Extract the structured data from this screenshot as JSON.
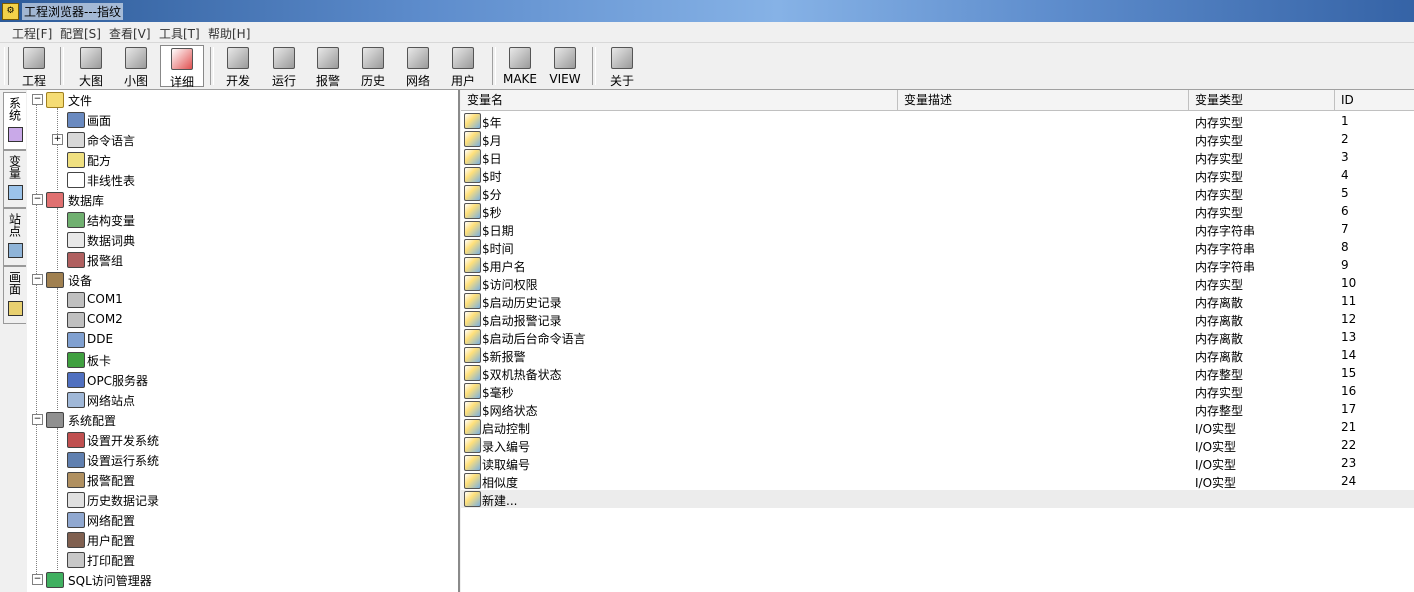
{
  "window": {
    "title": "工程浏览器---指纹"
  },
  "menu": [
    "工程[F]",
    "配置[S]",
    "查看[V]",
    "工具[T]",
    "帮助[H]"
  ],
  "toolbar": {
    "project": "工程",
    "large": "大图",
    "small": "小图",
    "detail": "详细",
    "develop": "开发",
    "run": "运行",
    "alarm": "报警",
    "history": "历史",
    "network": "网络",
    "user": "用户",
    "make": "MAKE",
    "view": "VIEW",
    "about": "关于"
  },
  "side_tabs": [
    "系统",
    "变量",
    "站点",
    "画面"
  ],
  "tree": {
    "file": "文件",
    "screen": "画面",
    "cmd_lang": "命令语言",
    "recipe": "配方",
    "nonlinear": "非线性表",
    "database": "数据库",
    "struct_var": "结构变量",
    "data_dict": "数据词典",
    "alarm_group": "报警组",
    "device": "设备",
    "com1": "COM1",
    "com2": "COM2",
    "dde": "DDE",
    "board": "板卡",
    "opc": "OPC服务器",
    "net_station": "网络站点",
    "sys_config": "系统配置",
    "dev_sys": "设置开发系统",
    "run_sys": "设置运行系统",
    "alarm_cfg": "报警配置",
    "hist_rec": "历史数据记录",
    "net_cfg": "网络配置",
    "user_cfg": "用户配置",
    "print_cfg": "打印配置",
    "sql": "SQL访问管理器"
  },
  "table": {
    "headers": {
      "name": "变量名",
      "desc": "变量描述",
      "type": "变量类型",
      "id": "ID"
    },
    "rows": [
      {
        "name": "$年",
        "type": "内存实型",
        "id": "1"
      },
      {
        "name": "$月",
        "type": "内存实型",
        "id": "2"
      },
      {
        "name": "$日",
        "type": "内存实型",
        "id": "3"
      },
      {
        "name": "$时",
        "type": "内存实型",
        "id": "4"
      },
      {
        "name": "$分",
        "type": "内存实型",
        "id": "5"
      },
      {
        "name": "$秒",
        "type": "内存实型",
        "id": "6"
      },
      {
        "name": "$日期",
        "type": "内存字符串",
        "id": "7"
      },
      {
        "name": "$时间",
        "type": "内存字符串",
        "id": "8"
      },
      {
        "name": "$用户名",
        "type": "内存字符串",
        "id": "9"
      },
      {
        "name": "$访问权限",
        "type": "内存实型",
        "id": "10"
      },
      {
        "name": "$启动历史记录",
        "type": "内存离散",
        "id": "11"
      },
      {
        "name": "$启动报警记录",
        "type": "内存离散",
        "id": "12"
      },
      {
        "name": "$启动后台命令语言",
        "type": "内存离散",
        "id": "13"
      },
      {
        "name": "$新报警",
        "type": "内存离散",
        "id": "14"
      },
      {
        "name": "$双机热备状态",
        "type": "内存整型",
        "id": "15"
      },
      {
        "name": "$毫秒",
        "type": "内存实型",
        "id": "16"
      },
      {
        "name": "$网络状态",
        "type": "内存整型",
        "id": "17"
      },
      {
        "name": "启动控制",
        "type": "I/O实型",
        "id": "21"
      },
      {
        "name": "录入编号",
        "type": "I/O实型",
        "id": "22"
      },
      {
        "name": "读取编号",
        "type": "I/O实型",
        "id": "23"
      },
      {
        "name": "相似度",
        "type": "I/O实型",
        "id": "24"
      }
    ],
    "new_item": "新建..."
  }
}
